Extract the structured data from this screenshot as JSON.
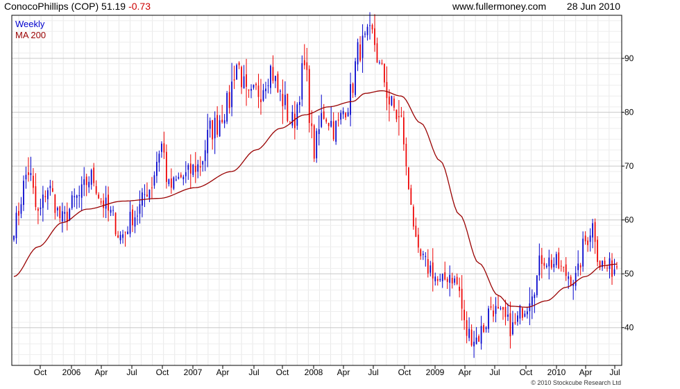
{
  "header": {
    "symbol_text": "ConocoPhillips (COP) 51.19",
    "change_text": "-0.73",
    "site": "www.fullermoney.com",
    "date": "28 Jun 2010"
  },
  "footer": {
    "copyright": "© 2010 Stockcube Research Ltd"
  },
  "colors": {
    "up": "#0000cc",
    "down": "#ee0000",
    "ma": "#990000",
    "grid": "#c8c8c8",
    "axis": "#000000",
    "change": "#cc0000"
  },
  "chart_data": {
    "type": "candlestick",
    "legend": [
      {
        "label": "Weekly",
        "color": "#0000cc"
      },
      {
        "label": "MA 200",
        "color": "#990000"
      }
    ],
    "legend_position": "top-left",
    "x_tick_labels": [
      "Oct",
      "2006",
      "Apr",
      "Jul",
      "Oct",
      "2007",
      "Apr",
      "Jul",
      "Oct",
      "2008",
      "Apr",
      "Jul",
      "Oct",
      "2009",
      "Apr",
      "Jul",
      "Oct",
      "2010",
      "Apr",
      "Jul"
    ],
    "y_ticks": [
      40,
      50,
      60,
      70,
      80,
      90
    ],
    "ylim": [
      33,
      98
    ],
    "y_axis_side": "right",
    "grid": true,
    "weeks_total": 250,
    "price_anchors": [
      [
        0,
        59
      ],
      [
        6,
        69
      ],
      [
        10,
        61
      ],
      [
        14,
        66
      ],
      [
        20,
        60
      ],
      [
        26,
        64
      ],
      [
        32,
        68
      ],
      [
        37,
        63
      ],
      [
        40,
        61
      ],
      [
        44,
        57
      ],
      [
        50,
        61
      ],
      [
        56,
        66
      ],
      [
        61,
        74
      ],
      [
        64,
        66
      ],
      [
        70,
        68
      ],
      [
        76,
        70
      ],
      [
        82,
        77
      ],
      [
        88,
        81
      ],
      [
        92,
        89
      ],
      [
        97,
        82
      ],
      [
        101,
        84
      ],
      [
        106,
        88
      ],
      [
        110,
        83
      ],
      [
        115,
        78
      ],
      [
        120,
        88
      ],
      [
        124,
        73
      ],
      [
        128,
        80
      ],
      [
        133,
        77
      ],
      [
        138,
        82
      ],
      [
        143,
        92
      ],
      [
        148,
        94
      ],
      [
        152,
        87
      ],
      [
        156,
        81
      ],
      [
        160,
        78
      ],
      [
        163,
        66
      ],
      [
        167,
        53
      ],
      [
        172,
        51
      ],
      [
        176,
        48
      ],
      [
        180,
        50
      ],
      [
        183,
        48
      ],
      [
        187,
        39
      ],
      [
        191,
        38
      ],
      [
        194,
        40
      ],
      [
        197,
        44
      ],
      [
        201,
        42
      ],
      [
        206,
        40
      ],
      [
        211,
        44
      ],
      [
        215,
        48
      ],
      [
        218,
        53
      ],
      [
        223,
        52
      ],
      [
        228,
        50
      ],
      [
        232,
        49
      ],
      [
        236,
        56
      ],
      [
        239,
        59
      ],
      [
        242,
        52
      ],
      [
        246,
        51
      ],
      [
        249,
        51.2
      ]
    ],
    "ma200_anchors": [
      [
        0,
        49.5
      ],
      [
        10,
        55
      ],
      [
        20,
        59.5
      ],
      [
        30,
        62
      ],
      [
        45,
        63.5
      ],
      [
        60,
        64
      ],
      [
        75,
        66
      ],
      [
        90,
        69
      ],
      [
        100,
        73
      ],
      [
        110,
        77
      ],
      [
        120,
        79.5
      ],
      [
        130,
        81
      ],
      [
        140,
        82
      ],
      [
        145,
        83.5
      ],
      [
        152,
        84
      ],
      [
        160,
        83
      ],
      [
        168,
        78
      ],
      [
        176,
        71
      ],
      [
        184,
        61
      ],
      [
        192,
        52
      ],
      [
        200,
        46
      ],
      [
        205,
        44
      ],
      [
        212,
        43.8
      ],
      [
        220,
        45
      ],
      [
        228,
        47.5
      ],
      [
        236,
        49.5
      ],
      [
        243,
        51.5
      ],
      [
        249,
        51.8
      ]
    ]
  }
}
